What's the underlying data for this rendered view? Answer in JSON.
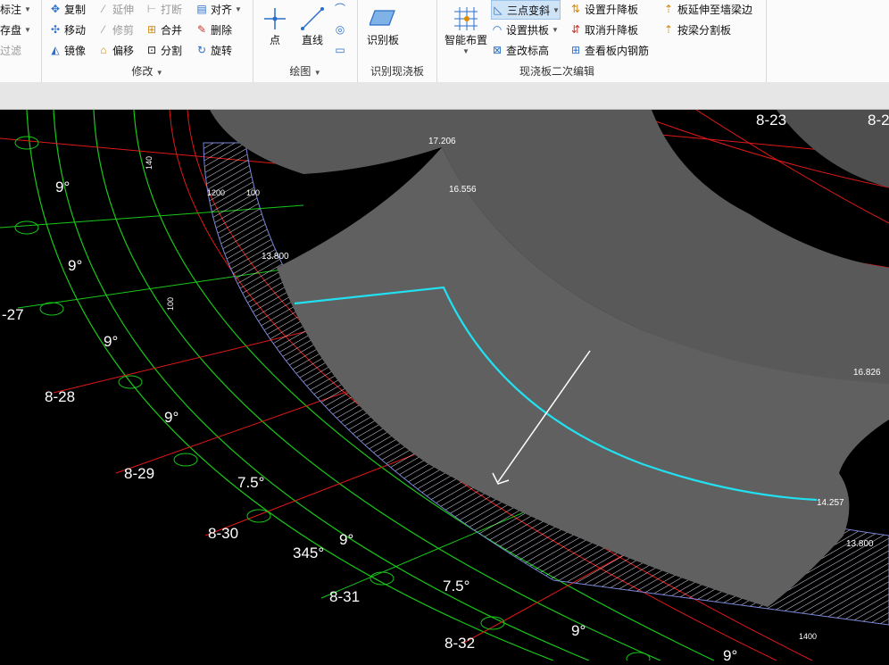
{
  "ribbon": {
    "left_partial": {
      "label_row1": "标注",
      "label_row2": "存盘",
      "label_row3": "过滤"
    },
    "modify": {
      "title": "修改",
      "copy": "复制",
      "extend": "延伸",
      "break": "打断",
      "align": "对齐",
      "move": "移动",
      "trim": "修剪",
      "merge": "合并",
      "delete": "删除",
      "mirror": "镜像",
      "offset": "偏移",
      "split": "分割",
      "rotate": "旋转"
    },
    "draw": {
      "title": "绘图",
      "point": "点",
      "line": "直线"
    },
    "identify": {
      "title": "识别现浇板",
      "identify_slab": "识别板"
    },
    "slab_edit": {
      "title": "现浇板二次编辑",
      "smart_layout": "智能布置",
      "three_point_slope": "三点变斜",
      "set_raise_lower": "设置升降板",
      "extend_to_wall_beam": "板延伸至墙梁边",
      "set_arch": "设置拱板",
      "cancel_raise_lower": "取消升降板",
      "split_by_beam": "按梁分割板",
      "check_elevation": "查改标高",
      "view_rebar": "查看板内钢筋"
    }
  },
  "canvas": {
    "axis_labels": [
      "8-23",
      "8-2",
      "-27",
      "8-28",
      "8-29",
      "8-30",
      "8-31",
      "8-32"
    ],
    "angle_labels": [
      "9°",
      "9°",
      "9°",
      "9°",
      "7.5°",
      "9°",
      "7.5°",
      "9°",
      "345°",
      "9°"
    ],
    "elevations": [
      "17.206",
      "16.556",
      "13.800",
      "16.826",
      "14.257",
      "13.800"
    ],
    "dims": [
      "1200",
      "100",
      "140",
      "100",
      "1400"
    ],
    "colors": {
      "slab": "#5a5a5a",
      "selection": "#22e0f0",
      "axis_green": "#19c819",
      "axis_red": "#e01818",
      "hatch": "#d8d8e8"
    }
  }
}
